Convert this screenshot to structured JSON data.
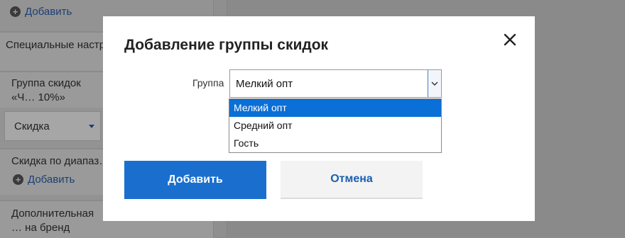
{
  "background": {
    "add_label_top": "Добавить",
    "special_settings_title": "Специальные настройки скидок/наценок",
    "group_title": "Группа скидок «Ч… 10%»",
    "type_select_value": "Скидка",
    "range_discount_title": "Скидка по диапаз…",
    "add_label_range": "Добавить",
    "brand_title": "Дополнительная … на бренд"
  },
  "modal": {
    "title": "Добавление группы скидок",
    "field_label": "Группа",
    "select_value": "Мелкий опт",
    "options": [
      "Мелкий опт",
      "Средний опт",
      "Гость"
    ],
    "selected_index": 0,
    "add_button": "Добавить",
    "cancel_button": "Отмена"
  },
  "icons": {
    "close": "close-icon",
    "dropdown_arrow": "chevron-down-icon",
    "plus": "plus-circle-icon"
  },
  "colors": {
    "primary": "#1a6fce",
    "selected_option": "#0a6fd6",
    "link": "#1a5fb4"
  }
}
